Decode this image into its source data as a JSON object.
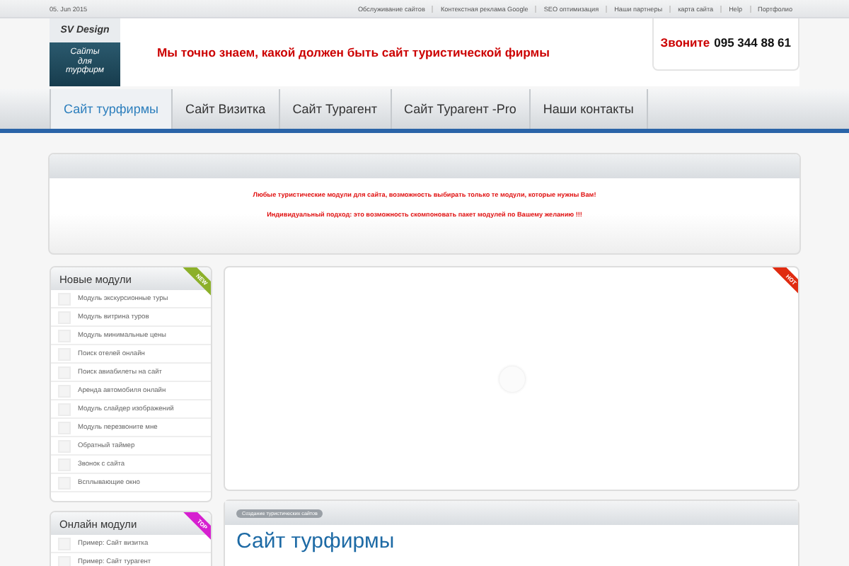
{
  "top_bar": {
    "date": "05. Jun 2015",
    "links": [
      "Обслуживание сайтов",
      "Контекстная реклама Google",
      "SEO оптимизация",
      "Наши партнеры",
      "карта сайта",
      "Help",
      "Портфолио"
    ]
  },
  "header": {
    "logo_title": "SV Design",
    "logo_text": "Сайты для турфирм",
    "slogan": "Мы точно знаем, какой должен быть сайт туристической фирмы",
    "phone_label": "Звоните",
    "phone": "095 344 88 61"
  },
  "nav": [
    {
      "label": "Сайт турфирмы",
      "selected": true
    },
    {
      "label": "Сайт Визитка",
      "selected": false
    },
    {
      "label": "Сайт Турагент",
      "selected": false
    },
    {
      "label": "Сайт Турагент -Pro",
      "selected": false
    },
    {
      "label": "Наши контакты",
      "selected": false
    }
  ],
  "banner": {
    "lines": [
      "Любые туристические модули для сайта, возможность выбирать только те модули, которые нужны Вам!",
      "Индивидуальный подход: это возможность скомпоновать пакет модулей по Вашему желанию !!!"
    ]
  },
  "sidebar": [
    {
      "title": "Новые модули",
      "ribbon": "NEW",
      "color": "#8cb02a",
      "items": [
        "Модуль экскурсионные туры",
        "Модуль витрина туров",
        "Модуль минимальные цены",
        "Поиск отелей онлайн",
        "Поиск авиабилеты на сайт",
        "Аренда автомобиля онлайн",
        "Модуль слайдер изображений",
        "Модуль перезвоните мне",
        "Обратный таймер",
        "Звонок с сайта",
        "Всплывающие окно"
      ]
    },
    {
      "title": "Онлайн модули",
      "ribbon": "TOP",
      "color": "#d61fd0",
      "items": [
        "Пример: Сайт визитка",
        "Пример: Сайт турагент"
      ]
    }
  ],
  "slider": {
    "ribbon": "HOT",
    "color": "#e02b10"
  },
  "article": {
    "breadcrumb": "Создание туристических сайтов",
    "title": "Сайт турфирмы"
  }
}
